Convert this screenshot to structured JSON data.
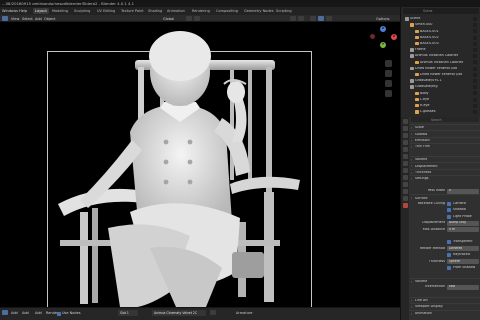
{
  "window": {
    "title": "...08/20180915 gmtrbondo/nesodlblender/Sidera2 - Blender 4.0.1 4.1"
  },
  "menu": {
    "items": [
      "Windows",
      "Help",
      "Layout",
      "Modeling",
      "Sculpting",
      "UV Editing",
      "Texture Paint",
      "Shading",
      "Animation",
      "Rendering",
      "Compositing",
      "Geometry Nodes",
      "Scripting"
    ]
  },
  "toolbar": {
    "items": [
      "View",
      "Select",
      "Add",
      "Object"
    ],
    "orientation": "Global",
    "options": "Options"
  },
  "status": {
    "left": [
      "Add",
      "Add",
      "Add",
      "Render",
      "Use Nodes"
    ],
    "slot": "Slot 1",
    "material": "Animus Cinematy Velvet 2C",
    "right": "Armature"
  },
  "outliner": {
    "search_placeholder": "Scene",
    "rows": [
      {
        "label": "Scene",
        "indent": 0,
        "color": "#9a9a9a"
      },
      {
        "label": "Smith.000",
        "indent": 1,
        "color": "#e0a050"
      },
      {
        "label": "BASES.001",
        "indent": 2,
        "color": "#e0a050"
      },
      {
        "label": "BASES.002",
        "indent": 2,
        "color": "#e0a050"
      },
      {
        "label": "BASES.003",
        "indent": 2,
        "color": "#e0a050"
      },
      {
        "label": "Frame",
        "indent": 1,
        "color": "#9a9a9a"
      },
      {
        "label": "Animus Victorian Cabinet",
        "indent": 1,
        "color": "#9a9a9a"
      },
      {
        "label": "Animus Victorian Cabinet",
        "indent": 2,
        "color": "#e0a050"
      },
      {
        "label": "Dried flower ceramic pot",
        "indent": 1,
        "color": "#9a9a9a"
      },
      {
        "label": "Dried flower ceramic pot",
        "indent": 2,
        "color": "#e0a050"
      },
      {
        "label": "Graduate/SYS.1",
        "indent": 1,
        "color": "#9a9a9a"
      },
      {
        "label": "Graduate/Rig",
        "indent": 1,
        "color": "#9a9a9a"
      },
      {
        "label": "Body",
        "indent": 2,
        "color": "#e0a050"
      },
      {
        "label": "L.eye",
        "indent": 2,
        "color": "#e0a050"
      },
      {
        "label": "R.eye",
        "indent": 2,
        "color": "#e0a050"
      },
      {
        "label": "L.glasses",
        "indent": 2,
        "color": "#e0a050"
      }
    ],
    "view_label": "Options"
  },
  "properties": {
    "search_placeholder": "Search",
    "rows": [
      {
        "type": "section",
        "label": "Scale",
        "y": 0
      },
      {
        "type": "section",
        "label": "Globals",
        "y": 1
      },
      {
        "type": "section",
        "label": "Emission",
        "y": 2
      },
      {
        "type": "section",
        "label": "Thin Film",
        "y": 3
      },
      {
        "type": "section",
        "label": "Volume",
        "y": 5
      },
      {
        "type": "section",
        "label": "Displacement",
        "y": 6
      },
      {
        "type": "section",
        "label": "Thickness",
        "y": 7
      },
      {
        "type": "section",
        "label": "Settings",
        "y": 8
      },
      {
        "type": "field",
        "label": "Pass Index",
        "value": "0",
        "y": 10
      },
      {
        "type": "section",
        "label": "Surface",
        "y": 11
      },
      {
        "type": "check",
        "label": "Backface Culling",
        "value": "Camera",
        "y": 12
      },
      {
        "type": "check",
        "label": "",
        "value": "Shadow",
        "y": 13
      },
      {
        "type": "check",
        "label": "",
        "value": "Light Probe",
        "y": 14
      },
      {
        "type": "field",
        "label": "Displacement",
        "value": "Bump Only",
        "y": 15
      },
      {
        "type": "field",
        "label": "Max Distance",
        "value": "0 m",
        "y": 16
      },
      {
        "type": "check",
        "label": "",
        "value": "Transparent",
        "y": 18
      },
      {
        "type": "field",
        "label": "Render Method",
        "value": "Dithered",
        "y": 19
      },
      {
        "type": "check",
        "label": "",
        "value": "Raytraced",
        "y": 20
      },
      {
        "type": "field",
        "label": "Thickness",
        "value": "Sphere",
        "y": 21
      },
      {
        "type": "check",
        "label": "",
        "value": "From Shadow",
        "y": 22
      },
      {
        "type": "section",
        "label": "Volume",
        "y": 24
      },
      {
        "type": "field",
        "label": "Intersection",
        "value": "Fast",
        "y": 25
      },
      {
        "type": "section",
        "label": "Line Art",
        "y": 27
      },
      {
        "type": "section",
        "label": "Viewport Display",
        "y": 28
      },
      {
        "type": "section",
        "label": "Animation",
        "y": 29
      }
    ]
  },
  "colors": {
    "accent": "#4772b3",
    "gizmo_x": "#e0474f",
    "gizmo_y": "#7fb63b",
    "gizmo_z": "#4c82d8"
  }
}
